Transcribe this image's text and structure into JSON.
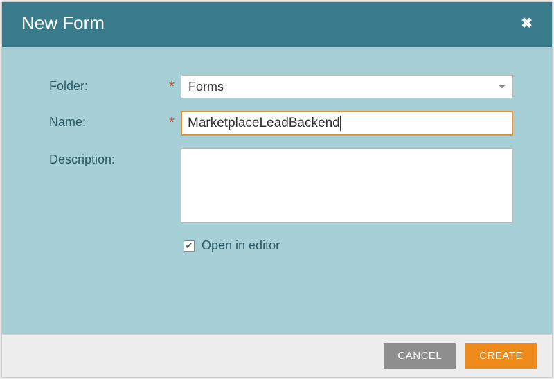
{
  "dialog": {
    "title": "New Form",
    "labels": {
      "folder": "Folder:",
      "name": "Name:",
      "description": "Description:"
    },
    "fields": {
      "folder_value": "Forms",
      "name_value": "MarketplaceLeadBackend",
      "description_value": ""
    },
    "checkbox": {
      "open_in_editor_label": "Open in editor",
      "checked": true
    },
    "buttons": {
      "cancel": "CANCEL",
      "create": "CREATE"
    },
    "required_marker": "*"
  }
}
